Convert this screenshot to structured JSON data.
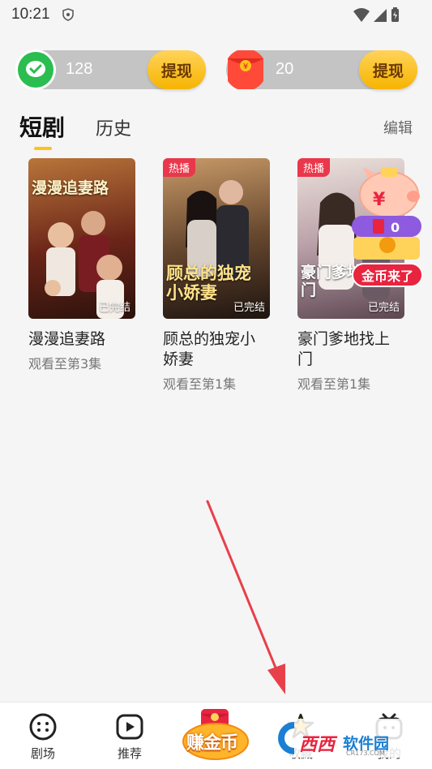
{
  "status_bar": {
    "time": "10:21"
  },
  "wallet": {
    "cash": {
      "amount": "128",
      "button": "提现"
    },
    "redpacket": {
      "amount": "20",
      "button": "提现"
    }
  },
  "tabs": {
    "active": "短剧",
    "other": "历史",
    "edit": "编辑"
  },
  "dramas": [
    {
      "title": "漫漫追妻路",
      "progress": "观看至第3集",
      "status": "已完结",
      "hot": "",
      "poster_text": "漫漫追妻路",
      "palette": [
        "#7a2a1a",
        "#c47a3a"
      ]
    },
    {
      "title": "顾总的独宠小娇妻",
      "progress": "观看至第1集",
      "status": "已完结",
      "hot": "热播",
      "poster_text": "顾总的独宠小娇妻",
      "palette": [
        "#3a2a20",
        "#a07850"
      ]
    },
    {
      "title": "豪门爹地找上门",
      "progress": "观看至第1集",
      "status": "已完结",
      "hot": "热播",
      "poster_text": "豪门爹地找上门",
      "palette": [
        "#d8c8c0",
        "#8a6a78"
      ]
    }
  ],
  "coin_widget": {
    "count": "0",
    "tag": "金币来了",
    "icon": "piggy-bank-icon"
  },
  "bottom_nav": {
    "items": [
      {
        "label": "剧场",
        "icon": "theater-icon"
      },
      {
        "label": "推荐",
        "icon": "play-icon"
      },
      {
        "label": "赚金币",
        "icon": "earn-coins-icon"
      },
      {
        "label": "收藏",
        "icon": "star-icon"
      },
      {
        "label": "我的",
        "icon": "tv-profile-icon"
      }
    ]
  },
  "watermark": {
    "brand": "西西",
    "site": "软件园",
    "url": "CR173.COM"
  },
  "colors": {
    "accent": "#ffc21a",
    "hot": "#e9374b",
    "arrow": "#e8404a"
  }
}
